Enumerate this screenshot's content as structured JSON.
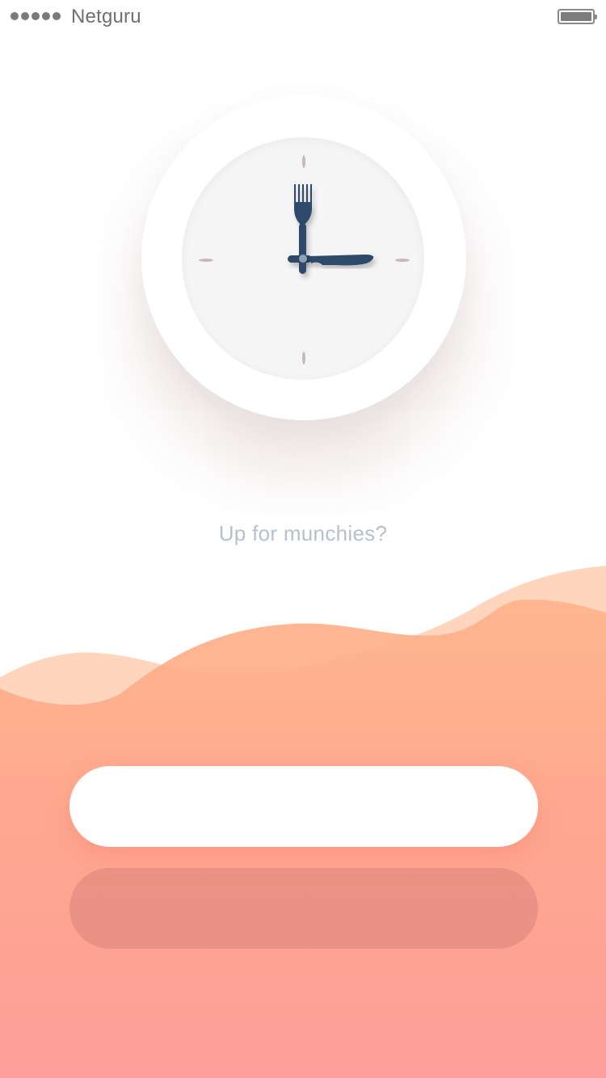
{
  "status_bar": {
    "carrier": "Netguru",
    "signal_bars": 5,
    "battery_icon": "battery-icon"
  },
  "clock": {
    "hands_icons": [
      "fork-icon",
      "knife-icon"
    ],
    "hour_marker_icon": "hour-marker-icon"
  },
  "tagline": "Up for munchies?",
  "buttons": {
    "primary_label": "",
    "secondary_label": ""
  },
  "colors": {
    "hands": "#2f4a6b",
    "wave_light": "#fdd2b6",
    "wave_top": "#ffad86",
    "wave_bottom": "#ff9b98",
    "tagline": "#b8c0c8"
  }
}
